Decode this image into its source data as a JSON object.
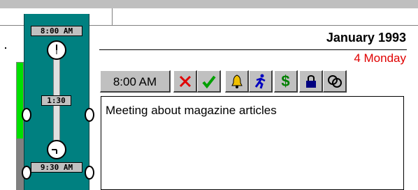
{
  "timeline": {
    "start_time": "8:00 AM",
    "duration": "1:30",
    "end_time": "9:30 AM",
    "progress_fraction": 0.6
  },
  "header": {
    "month_year": "January 1993",
    "day": "4 Monday"
  },
  "toolbar": {
    "time_value": "8:00 AM",
    "buttons": [
      {
        "icon": "delete-x-icon",
        "color": "#e00000"
      },
      {
        "icon": "checkmark-icon",
        "color": "#00a000"
      },
      {
        "icon": "alarm-bell-icon",
        "color": "#f0c000"
      },
      {
        "icon": "running-man-icon",
        "color": "#0000c0"
      },
      {
        "icon": "dollar-icon",
        "color": "#008000"
      },
      {
        "icon": "lock-icon",
        "color": "#000080"
      },
      {
        "icon": "link-circles-icon",
        "color": "#000000"
      }
    ]
  },
  "note": {
    "text": "Meeting about magazine articles"
  },
  "colors": {
    "panel": "#008080",
    "accent_red": "#e00000",
    "progress_green": "#00e000"
  }
}
